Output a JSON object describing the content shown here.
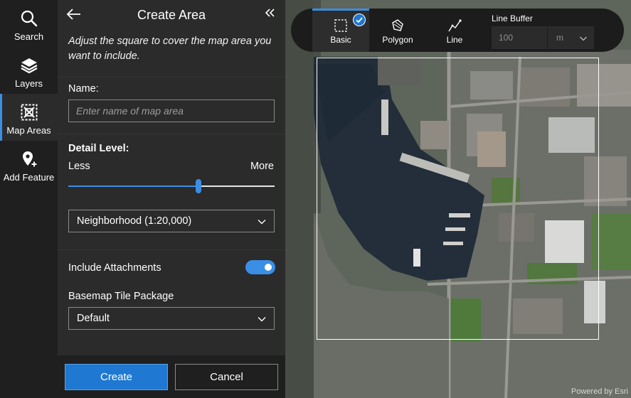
{
  "rail": {
    "items": [
      {
        "label": "Search",
        "icon": "search-icon"
      },
      {
        "label": "Layers",
        "icon": "layers-icon"
      },
      {
        "label": "Map Areas",
        "icon": "map-areas-icon",
        "active": true
      },
      {
        "label": "Add Feature",
        "icon": "add-feature-icon"
      }
    ]
  },
  "panel": {
    "title": "Create Area",
    "description": "Adjust the square to cover the map area you want to include.",
    "name_label": "Name:",
    "name_value": "",
    "name_placeholder": "Enter name of map area",
    "detail_label": "Detail Level:",
    "less_label": "Less",
    "more_label": "More",
    "detail_slider_fraction": 0.63,
    "detail_value": "Neighborhood (1:20,000)",
    "attachments_label": "Include Attachments",
    "attachments_on": true,
    "basemap_label": "Basemap Tile Package",
    "basemap_value": "Default",
    "create_label": "Create",
    "cancel_label": "Cancel"
  },
  "toolbar": {
    "tools": [
      {
        "label": "Basic",
        "icon": "rectangle-select-icon",
        "active": true
      },
      {
        "label": "Polygon",
        "icon": "polygon-icon"
      },
      {
        "label": "Line",
        "icon": "line-icon"
      }
    ],
    "buffer_label": "Line Buffer",
    "buffer_value": "100",
    "buffer_unit": "m"
  },
  "map": {
    "attribution": "Powered by Esri"
  },
  "colors": {
    "accent": "#3a8ee6",
    "primary_button": "#1f78d1",
    "panel": "#2b2b2b",
    "rail": "#1f1f1f"
  }
}
